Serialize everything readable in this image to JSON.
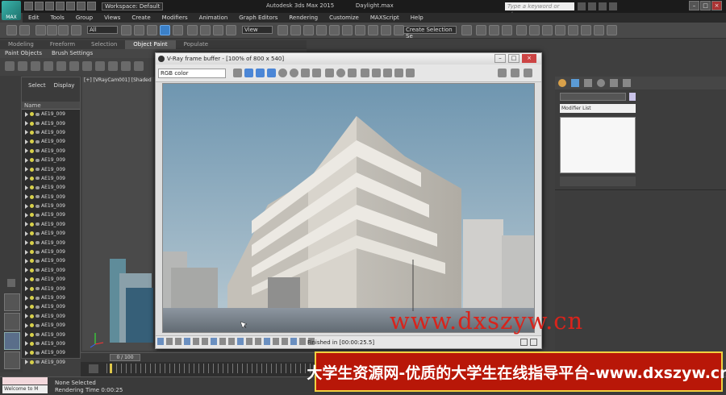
{
  "window": {
    "app_title": "Autodesk 3ds Max 2015",
    "file": "Daylight.max",
    "workspace": "Workspace: Default",
    "search_placeholder": "Type a keyword or phrase",
    "logo": "MAX"
  },
  "menu": [
    "Edit",
    "Tools",
    "Group",
    "Views",
    "Create",
    "Modifiers",
    "Animation",
    "Graph Editors",
    "Rendering",
    "Customize",
    "MAXScript",
    "Help"
  ],
  "toolbar": {
    "selection_filter": "All",
    "ref_coord": "View",
    "named_selection": "Create Selection Se"
  },
  "ribbon": {
    "tabs": [
      "Modeling",
      "Freeform",
      "Selection",
      "Object Paint",
      "Populate"
    ],
    "active_tab": "Object Paint",
    "sub": [
      "Paint Objects",
      "Brush Settings"
    ]
  },
  "explorer": {
    "tabs": [
      "Select",
      "Display"
    ],
    "column": "Name",
    "rows": [
      "AE19_009",
      "AE19_009",
      "AE19_009",
      "AE19_009",
      "AE19_009",
      "AE19_009",
      "AE19_009",
      "AE19_009",
      "AE19_009",
      "AE19_009",
      "AE19_009",
      "AE19_009",
      "AE19_009",
      "AE19_009",
      "AE19_009",
      "AE19_009",
      "AE19_009",
      "AE19_009",
      "AE19_009",
      "AE19_009",
      "AE19_009",
      "AE19_009",
      "AE19_009",
      "AE19_009",
      "AE19_009",
      "AE19_009",
      "AE19_009",
      "AE19_009"
    ]
  },
  "viewport": {
    "label": "[+] [VRayCam001] [Shaded"
  },
  "command_panel": {
    "modifier_list": "Modifier List"
  },
  "vfb": {
    "title": "V-Ray frame buffer - [100% of 800 x 540]",
    "channel": "RGB color",
    "status": "Finished in [00:00:25.5]"
  },
  "timeline": {
    "frame": "0 / 100"
  },
  "status": {
    "selection": "None Selected",
    "render_time": "Rendering Time  0:00:25",
    "listener": "Welcome to M"
  },
  "watermark": {
    "url": "www.dxszyw.cn",
    "banner": "大学生资源网-优质的大学生在线指导平台-www.dxszyw.cn"
  }
}
